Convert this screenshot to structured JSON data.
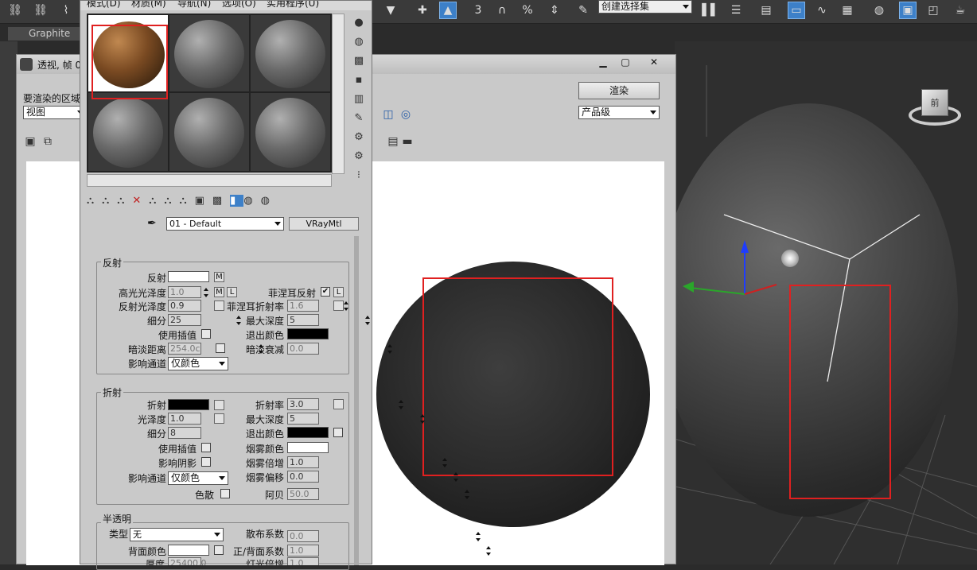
{
  "menu": {
    "items": [
      "模式(D)",
      "材质(M)",
      "导航(N)",
      "选项(O)",
      "实用程序(U)"
    ]
  },
  "toolbar": {
    "selection_set_placeholder": "创建选择集",
    "graphite_tab": "Graphite"
  },
  "render_frame": {
    "title": "透视, 帧 0",
    "area_label": "要渲染的区域",
    "area_value": "视图",
    "render_button": "渲染",
    "preset_value": "产品级"
  },
  "material_editor": {
    "material_name": "01 - Default",
    "material_type": "VRayMtl"
  },
  "reflection": {
    "title": "反射",
    "reflect_label": "反射",
    "m": "M",
    "hilight_gloss_label": "高光光泽度",
    "hilight_gloss": "1.0",
    "l": "L",
    "fresnel_label": "菲涅耳反射",
    "refl_gloss_label": "反射光泽度",
    "refl_gloss": "0.9",
    "fresnel_ior_label": "菲涅耳折射率",
    "fresnel_ior": "1.6",
    "subdivs_label": "细分",
    "subdivs": "25",
    "max_depth_label": "最大深度",
    "max_depth": "5",
    "use_interp_label": "使用插值",
    "exit_color_label": "退出颜色",
    "dim_dist_label": "暗淡距离",
    "dim_dist": "254.0c",
    "dim_falloff_label": "暗淡衰减",
    "dim_falloff": "0.0",
    "affect_channels_label": "影响通道",
    "affect_channels": "仅颜色"
  },
  "refraction": {
    "title": "折射",
    "refract_label": "折射",
    "ior_label": "折射率",
    "ior": "3.0",
    "gloss_label": "光泽度",
    "gloss": "1.0",
    "max_depth_label": "最大深度",
    "max_depth": "5",
    "subdivs_label": "细分",
    "subdivs": "8",
    "exit_color_label": "退出颜色",
    "use_interp_label": "使用插值",
    "fog_color_label": "烟雾颜色",
    "affect_shadows_label": "影响阴影",
    "fog_mult_label": "烟雾倍增",
    "fog_mult": "1.0",
    "affect_channels_label": "影响通道",
    "affect_channels": "仅颜色",
    "fog_bias_label": "烟雾偏移",
    "fog_bias": "0.0",
    "dispersion_label": "色散",
    "abbe_label": "阿贝",
    "abbe": "50.0"
  },
  "translucency": {
    "title": "半透明",
    "type_label": "类型",
    "type_value": "无",
    "scatter_label": "散布系数",
    "scatter": "0.0",
    "back_color_label": "背面颜色",
    "fb_label": "正/背面系数",
    "fb": "1.0",
    "thickness_label": "厚度",
    "thickness": "25400.0",
    "light_mult_label": "灯光倍增",
    "light_mult": "1.0"
  },
  "viewport": {
    "viewcube_label": "前"
  },
  "colors": {
    "ui_bg": "#c9c9c9",
    "dark_bg": "#2b2b2b",
    "accent": "#3d80c8",
    "highlight": "#e02020"
  }
}
